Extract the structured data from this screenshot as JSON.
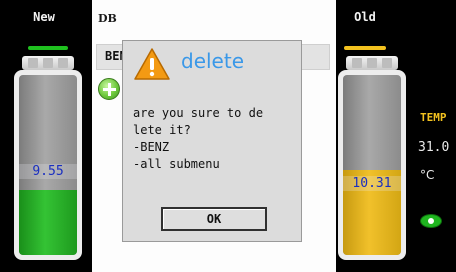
{
  "left_panel": {
    "title": "New",
    "value": "9.55",
    "level_fraction": 0.36,
    "accent_color": "#1fc11f"
  },
  "right_panel": {
    "title": "Old",
    "value": "10.31",
    "level_fraction": 0.47,
    "accent_color": "#f3c21f",
    "temp_label": "TEMP",
    "temp_value": "31.0",
    "temp_unit": "°C",
    "status_icon": "eye-icon"
  },
  "main": {
    "title": "DB",
    "list_item": "BENZ",
    "add_icon": "plus-circle-icon"
  },
  "dialog": {
    "title": "delete",
    "icon": "warning-triangle-icon",
    "message": "are you sure to de\nlete it?\n-BENZ\n-all submenu",
    "ok_label": "OK"
  }
}
